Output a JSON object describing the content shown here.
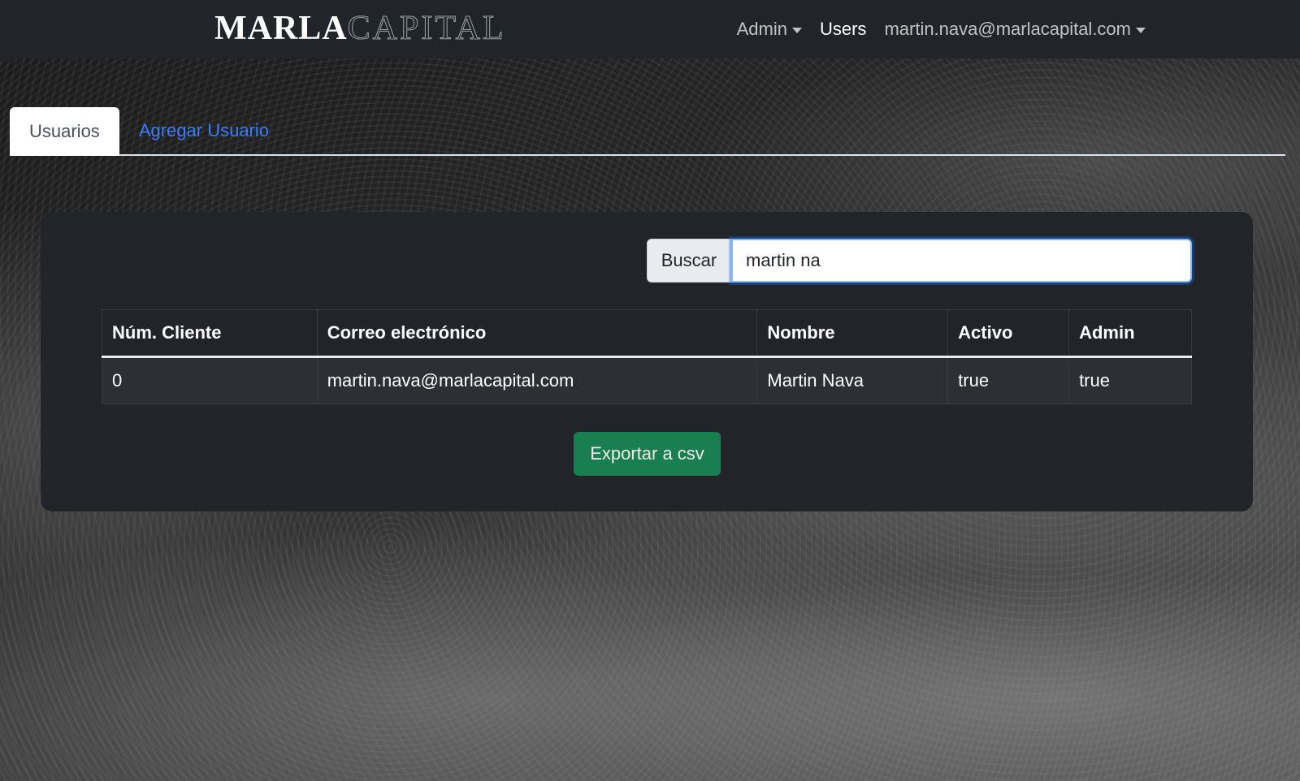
{
  "navbar": {
    "brand_bold": "MARLA",
    "brand_light": "CAPITAL",
    "links": {
      "admin": "Admin",
      "users": "Users",
      "account": "martin.nava@marlacapital.com"
    }
  },
  "tabs": {
    "users": "Usuarios",
    "add_user": "Agregar Usuario"
  },
  "search": {
    "label": "Buscar",
    "value": "martin na"
  },
  "table": {
    "headers": [
      "Núm. Cliente",
      "Correo electrónico",
      "Nombre",
      "Activo",
      "Admin"
    ],
    "rows": [
      [
        "0",
        "martin.nava@marlacapital.com",
        "Martin Nava",
        "true",
        "true"
      ]
    ]
  },
  "export_button": "Exportar a csv",
  "colors": {
    "navbar": "#212529",
    "link_blue": "#3d7bfd",
    "export_green": "#198754"
  }
}
